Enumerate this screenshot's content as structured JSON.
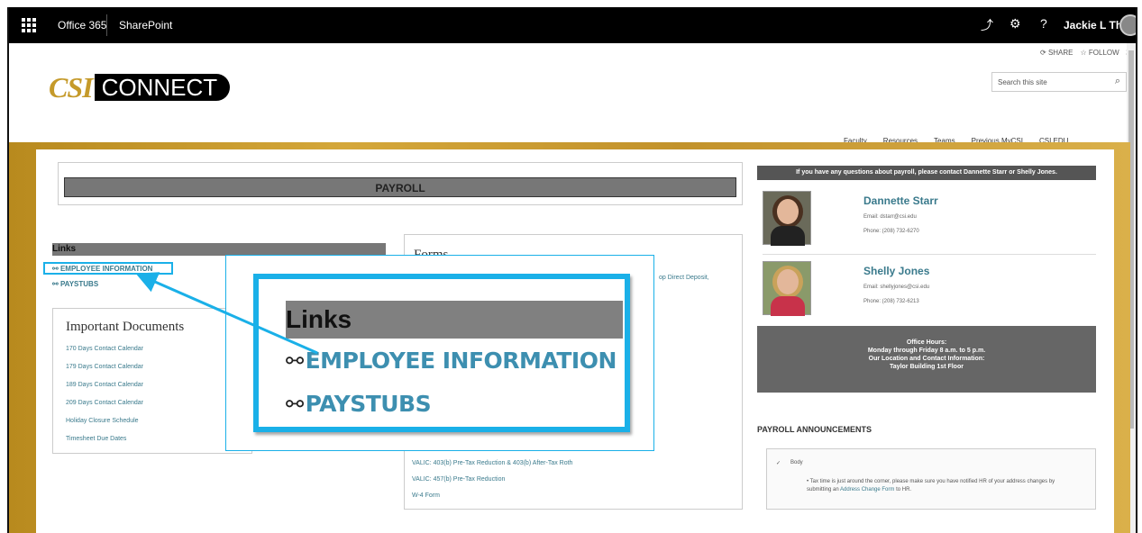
{
  "suitebar": {
    "office365": "Office 365",
    "sharepoint": "SharePoint",
    "help": "?",
    "user": "Jackie L Throng..."
  },
  "site_actions": {
    "share": "SHARE",
    "follow": "FOLLOW"
  },
  "logo": {
    "csi": "CSI",
    "connect": "CONNECT"
  },
  "search": {
    "placeholder": "Search this site"
  },
  "topnav": [
    "Faculty",
    "Resources",
    "Teams",
    "Previous MyCSI",
    "CSI.EDU"
  ],
  "main": {
    "title": "PAYROLL",
    "links_heading": "Links",
    "links": [
      "EMPLOYEE INFORMATION",
      "PAYSTUBS"
    ],
    "important_docs": {
      "heading": "Important Documents",
      "items": [
        "170 Days Contact Calendar",
        "179 Days Contact Calendar",
        "189 Days Contact Calendar",
        "209 Days Contact Calendar",
        "Holiday Closure Schedule",
        "Timesheet Due Dates"
      ]
    },
    "forms": {
      "heading": "Forms",
      "partial_right": "op Direct Deposit,",
      "items": [
        "VALIC: 403(b) Pre-Tax Reduction & 403(b) After-Tax Roth",
        "VALIC: 457(b) Pre-Tax Reduction",
        "W-4 Form"
      ]
    }
  },
  "contacts": {
    "header": "If you have any questions about payroll, please contact Dannette Starr or Shelly Jones.",
    "people": [
      {
        "name": "Dannette Starr",
        "email": "Email: dstarr@csi.edu",
        "phone": "Phone: (208) 732-6270"
      },
      {
        "name": "Shelly Jones",
        "email": "Email: shellyjones@csi.edu",
        "phone": "Phone: (208) 732-6213"
      }
    ],
    "hours": {
      "line1": "Office Hours:",
      "line2": "Monday through Friday 8 a.m. to 5 p.m.",
      "line3": "Our Location and Contact Information:",
      "line4": "Taylor Building 1st Floor"
    }
  },
  "announcements": {
    "title": "PAYROLL ANNOUNCEMENTS",
    "check": "✓",
    "body_label": "Body",
    "text_before": "Tax time is just around the corner, please make sure you have notified HR of your address changes by submitting an ",
    "link": "Address Change Form",
    "text_after": " to HR."
  },
  "callout": {
    "heading": "Links",
    "links": [
      "EMPLOYEE INFORMATION",
      "PAYSTUBS"
    ]
  },
  "colors": {
    "highlight": "#1ab0e8",
    "link": "#3a7a8c",
    "gold": "#c59a2a"
  }
}
